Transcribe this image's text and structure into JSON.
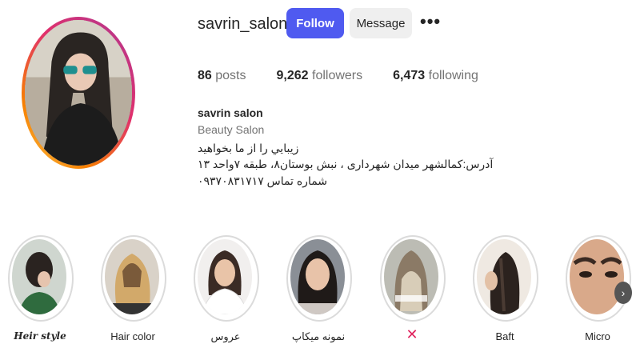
{
  "profile": {
    "username": "savrin_salon",
    "follow_label": "Follow",
    "message_label": "Message",
    "more_label": "•••"
  },
  "stats": {
    "posts_count": "86",
    "posts_label": "posts",
    "followers_count": "9,262",
    "followers_label": "followers",
    "following_count": "6,473",
    "following_label": "following"
  },
  "bio": {
    "name": "savrin salon",
    "category": "Beauty Salon",
    "line1": "زيبايي را از ما بخواهيد",
    "line2": "آدرس:کمالشهر میدان شهرداری ، نبش بوستان۸، طبقه ۷واحد ۱۳",
    "line3": "شماره تماس ۰۹۳۷۰۸۳۱۷۱۷"
  },
  "highlights": [
    {
      "label": "Heir style"
    },
    {
      "label": "Hair color"
    },
    {
      "label": "عروس"
    },
    {
      "label": "نمونه میکاپ"
    },
    {
      "label": "✕"
    },
    {
      "label": "Baft"
    },
    {
      "label": "Micro"
    }
  ],
  "colors": {
    "follow_button": "#4f5af0",
    "message_button": "#efefef",
    "close_mark": "#e0245e"
  },
  "icons": {
    "more": "more-horizontal-icon",
    "next": "chevron-right-icon"
  },
  "next_label": "›"
}
